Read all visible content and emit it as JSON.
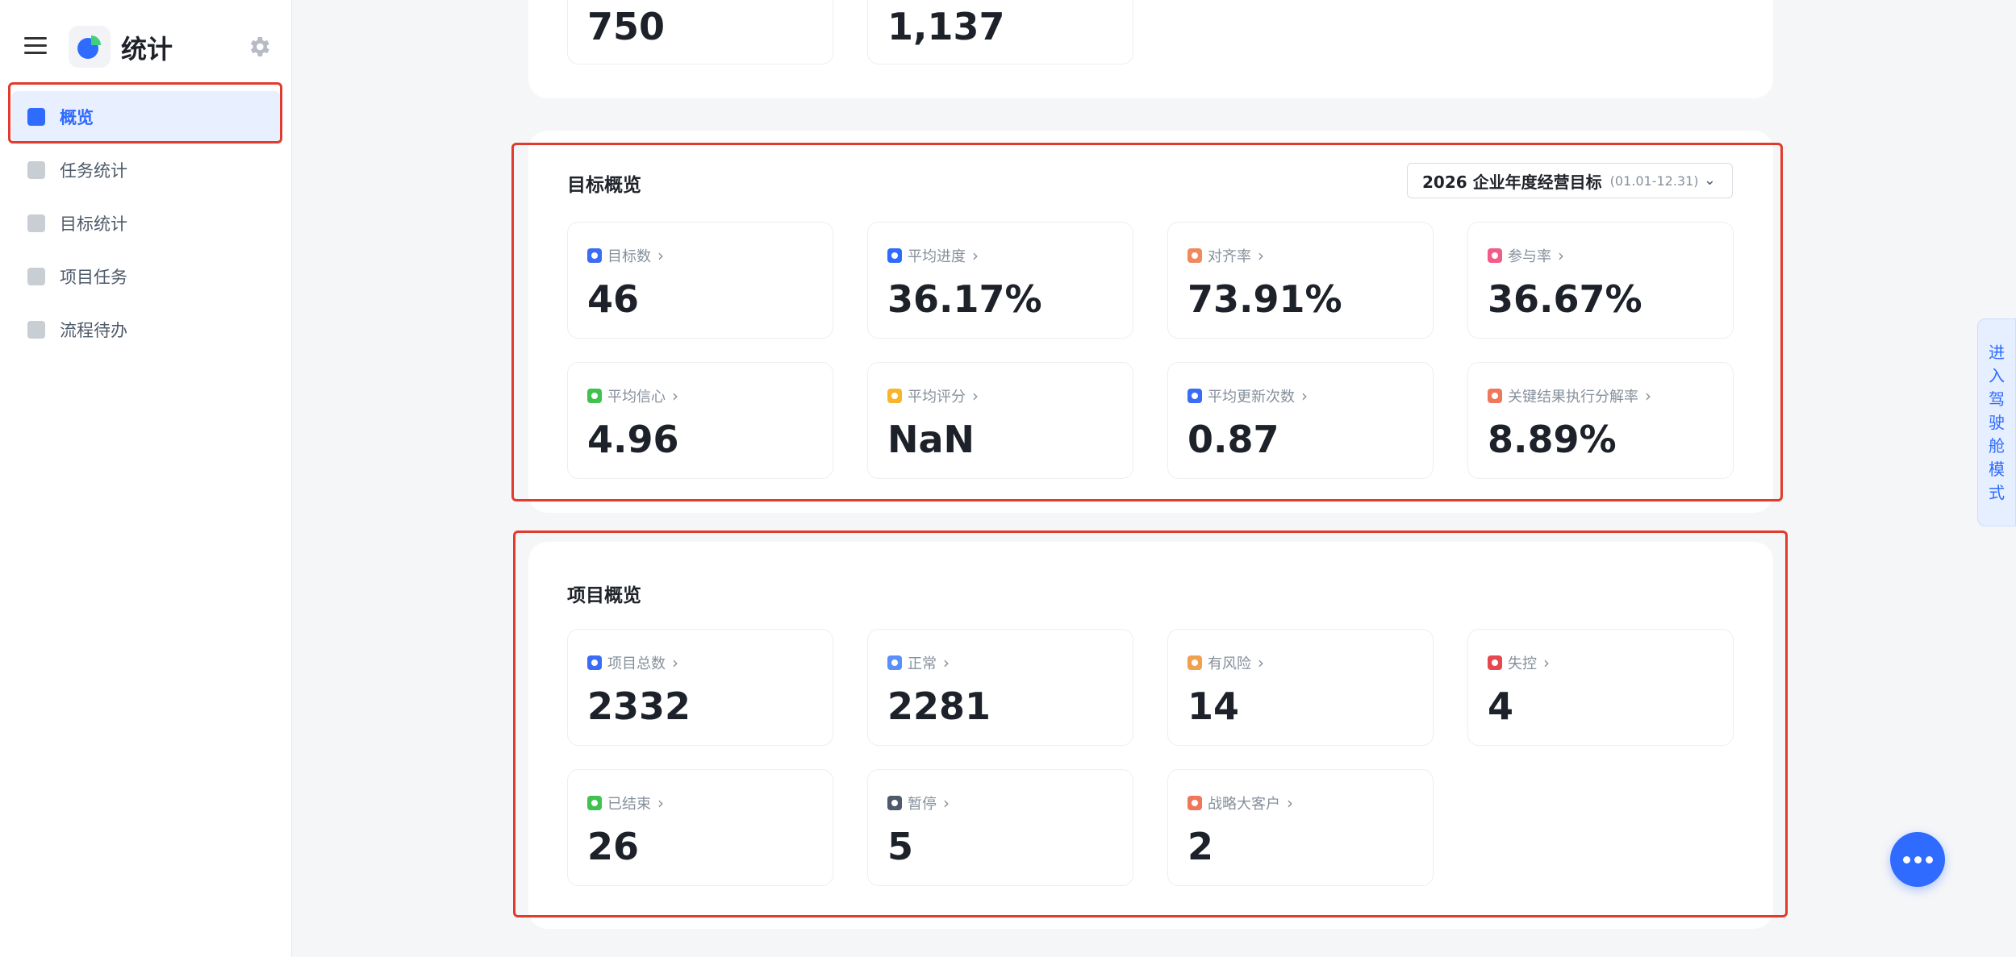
{
  "app": {
    "title": "统计"
  },
  "sidebar": {
    "items": [
      {
        "label": "概览",
        "active": true
      },
      {
        "label": "任务统计"
      },
      {
        "label": "目标统计"
      },
      {
        "label": "项目任务"
      },
      {
        "label": "流程待办"
      }
    ]
  },
  "top_stats": {
    "values": [
      "750",
      "1,137"
    ]
  },
  "goal_overview": {
    "title": "目标概览",
    "selector": {
      "label": "2026 企业年度经营目标",
      "range": "(01.01-12.31)"
    },
    "stats": [
      {
        "label": "目标数",
        "value": "46",
        "color": "#3b6cf6"
      },
      {
        "label": "平均进度",
        "value": "36.17%",
        "color": "#2f6bff"
      },
      {
        "label": "对齐率",
        "value": "73.91%",
        "color": "#f08a5d"
      },
      {
        "label": "参与率",
        "value": "36.67%",
        "color": "#f25c8a"
      },
      {
        "label": "平均信心",
        "value": "4.96",
        "color": "#3fc24f"
      },
      {
        "label": "平均评分",
        "value": "NaN",
        "color": "#f7b52c"
      },
      {
        "label": "平均更新次数",
        "value": "0.87",
        "color": "#3b6cf6"
      },
      {
        "label": "关键结果执行分解率",
        "value": "8.89%",
        "color": "#f0785a"
      }
    ]
  },
  "project_overview": {
    "title": "项目概览",
    "stats": [
      {
        "label": "项目总数",
        "value": "2332",
        "color": "#3b6cf6"
      },
      {
        "label": "正常",
        "value": "2281",
        "color": "#5b8ff9"
      },
      {
        "label": "有风险",
        "value": "14",
        "color": "#f0a050"
      },
      {
        "label": "失控",
        "value": "4",
        "color": "#e5484d"
      },
      {
        "label": "已结束",
        "value": "26",
        "color": "#3fc24f"
      },
      {
        "label": "暂停",
        "value": "5",
        "color": "#4e5969"
      },
      {
        "label": "战略大客户",
        "value": "2",
        "color": "#f0785a"
      }
    ]
  },
  "cockpit_mode": {
    "chars": [
      "进",
      "入",
      "驾",
      "驶",
      "舱",
      "模",
      "式"
    ]
  },
  "colors": {
    "accent": "#2f6bff",
    "highlight": "#e23b2e"
  },
  "icons": {
    "menu": "hamburger-icon",
    "settings": "gear-icon",
    "more": "ellipsis-icon"
  }
}
